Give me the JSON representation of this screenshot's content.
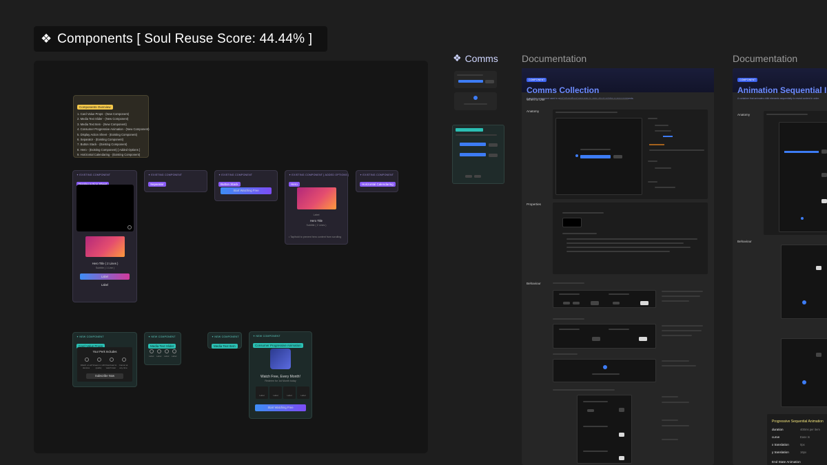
{
  "section": {
    "glyph": "❖",
    "title": "Components [ Soul Reuse Score: 44.44% ]"
  },
  "overview": {
    "tag": "Components Overview",
    "items": [
      "1. Card Value Props - (New Component)",
      "2. Media Text Slider - (New Component)",
      "3. Media Text Item - (New Component)",
      "4. Consumer Progressive Animation - (New Component)",
      "5. Display Action Sheet - (Existing Component)",
      "6. Separator - (Existing Component)",
      "7. Button Stack - (Existing Component)",
      "8. Hero - (Existing Component) [ Added Options ]",
      "9. Horizontal Calendaring - (Existing Component)"
    ]
  },
  "cards": {
    "display_action_sheet": {
      "kind": "✦ EXISTING COMPONENT",
      "badge": "Display Action Sheet",
      "hero_title": "Hero Title ( 2 Lines )",
      "hero_sub": "Subtitle ( 1 Line )",
      "primary": "Label",
      "secondary": "Label"
    },
    "separator": {
      "kind": "✦ EXISTING COMPONENT",
      "badge": "Separator"
    },
    "button_stack": {
      "kind": "✦ EXISTING COMPONENT",
      "badge": "Button Stack",
      "button": "Start Watching Free"
    },
    "hero": {
      "kind": "✦ EXISTING COMPONENT [ ADDED OPTIONS ]",
      "badge": "Hero",
      "hero_title": "Hero Title",
      "hero_sub": "Subtitle ( 2 Lines )",
      "caption": "Label",
      "note": "• Tap/hold to prevent hero content from scrolling"
    },
    "horizontal_calendaring": {
      "kind": "✦ EXISTING COMPONENT",
      "badge": "Horizontal Calendaring"
    },
    "card_value_props": {
      "kind": "✦ NEW COMPONENT",
      "badge": "Card Value Props",
      "heading": "Your Perk Includes",
      "items": [
        "Watch on all devices",
        "Stream in HD quality",
        "Download to watch later",
        "Cancel at any time"
      ],
      "button": "Subscribe Now"
    },
    "media_text_slider": {
      "kind": "✦ NEW COMPONENT",
      "badge": "Media Text Slider",
      "items": [
        "Label",
        "Label",
        "Label",
        "Label"
      ]
    },
    "media_text_item": {
      "kind": "✦ NEW COMPONENT",
      "badge": "Media Text Item"
    },
    "consumer_progressive_animation": {
      "kind": "✦ NEW COMPONENT",
      "badge": "Consumer Progressive Animation",
      "title": "Watch Free, Every Month!",
      "sub": "Redeem for 1st Month today",
      "steps": [
        "Label",
        "Label",
        "Label",
        "Label"
      ],
      "button": "Start Watching Free"
    }
  },
  "comms_small": {
    "glyph": "❖",
    "title": "Comms"
  },
  "doc1": {
    "header": "Documentation",
    "banner_label": "COMPONENT",
    "title": "Comms Collection",
    "subtitle": "A modular component used to send informational messages to users about updates or announcements.",
    "rows": [
      "When to Use",
      "Anatomy",
      "Properties",
      "Behaviour"
    ]
  },
  "doc2": {
    "header": "Documentation",
    "banner_label": "COMPONENT",
    "title": "Animation Sequential In",
    "subtitle": "A container that animates child elements sequentially to reveal content in order.",
    "rows": [
      "Anatomy",
      "Behaviour"
    ],
    "table_title": "Progressive Sequential Animation",
    "table": [
      {
        "k": "duration",
        "v": "400ms per item"
      },
      {
        "k": "curve",
        "v": "Ease In"
      },
      {
        "k": "x translation",
        "v": "0px"
      },
      {
        "k": "y translation",
        "v": "16px"
      }
    ],
    "footer": "End State Animation"
  },
  "colors": {
    "accent_purple": "#8a5cf6",
    "accent_teal": "#2bbfb3",
    "accent_blue": "#3d7cf5"
  }
}
